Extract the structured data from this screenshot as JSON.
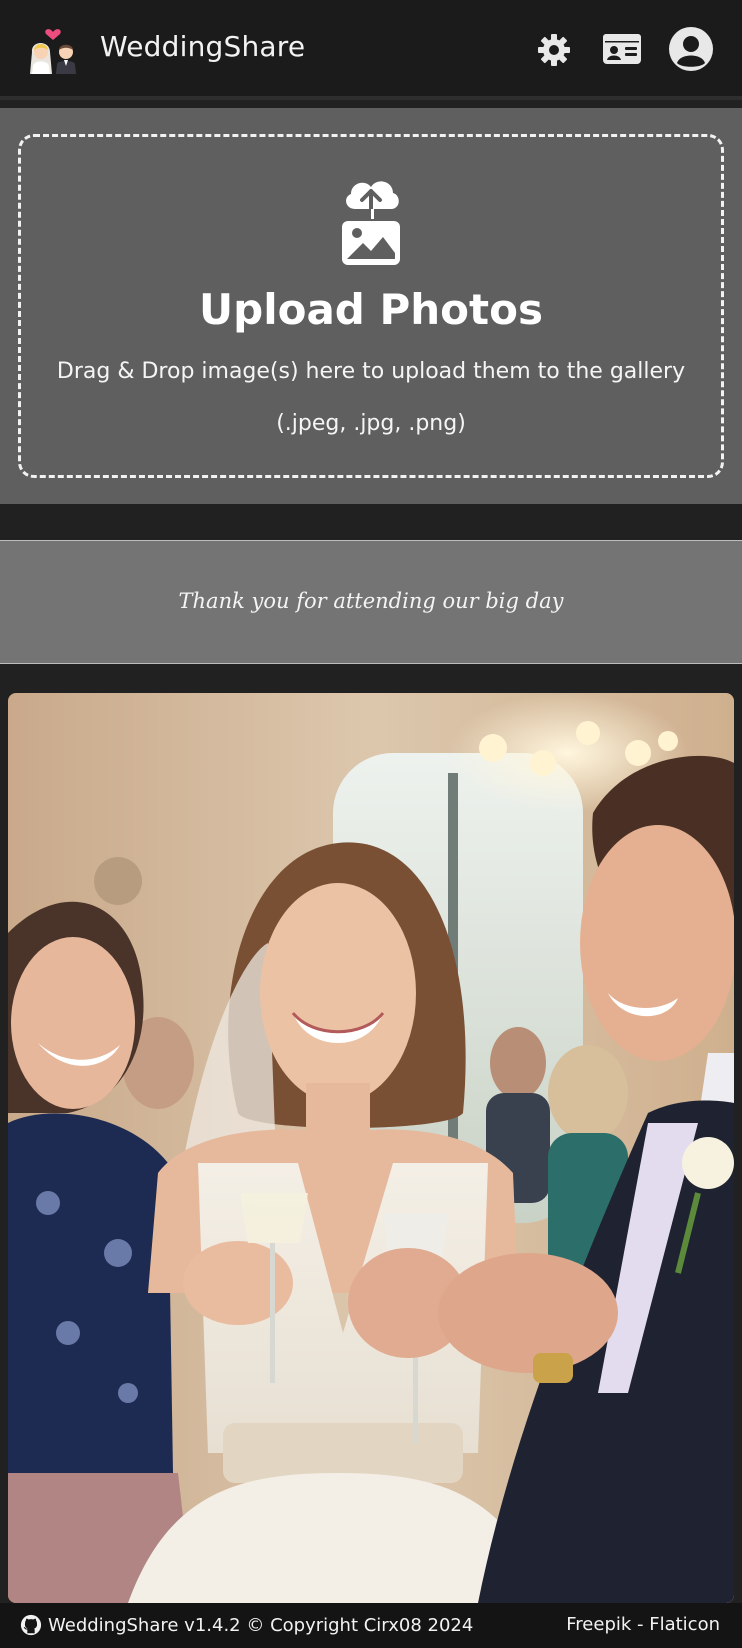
{
  "navbar": {
    "brand_name": "WeddingShare",
    "logo_icon": "bride-and-groom-icon",
    "settings_icon": "gear-icon",
    "card_icon": "id-card-icon",
    "account_icon": "user-circle-icon"
  },
  "upload": {
    "title": "Upload Photos",
    "description": "Drag & Drop image(s) here to upload them to the gallery",
    "file_types": "(.jpeg, .jpg, .png)",
    "icon": "cloud-upload-image-icon"
  },
  "message": {
    "text": "Thank you for attending our big day"
  },
  "gallery": {
    "photo_subject": "wedding-toast-photo"
  },
  "footer": {
    "left_text": "WeddingShare v1.4.2 © Copyright Cirx08 2024",
    "right_text": "Freepik - Flaticon",
    "github_icon": "github-icon"
  },
  "colors": {
    "navbar_bg": "#1b1b1b",
    "page_bg": "#212121",
    "upload_bg": "#5f5f5f",
    "message_bg": "#747474",
    "footer_bg": "#141414"
  }
}
